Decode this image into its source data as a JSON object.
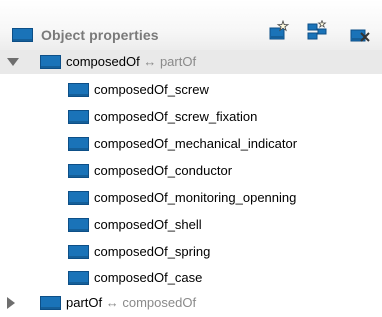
{
  "header": {
    "title": "Object properties",
    "icons": [
      "object-property-icon",
      "add-subproperty-icon",
      "add-sibling-property-icon",
      "delete-property-icon"
    ]
  },
  "colors": {
    "property_square": "#1a73b8",
    "header_text": "#7a7a7a",
    "inverse_text": "#8a8a8a",
    "selected_row": "#e9e9e9"
  },
  "tree": {
    "root1": {
      "name": "composedOf",
      "arrow": "↔",
      "inverse": "partOf",
      "expanded": true
    },
    "children": [
      "composedOf_screw",
      "composedOf_screw_fixation",
      "composedOf_mechanical_indicator",
      "composedOf_conductor",
      "composedOf_monitoring_openning",
      "composedOf_shell",
      "composedOf_spring",
      "composedOf_case"
    ],
    "root2": {
      "name": "partOf",
      "arrow": "↔",
      "inverse": "composedOf",
      "expanded": false
    }
  }
}
